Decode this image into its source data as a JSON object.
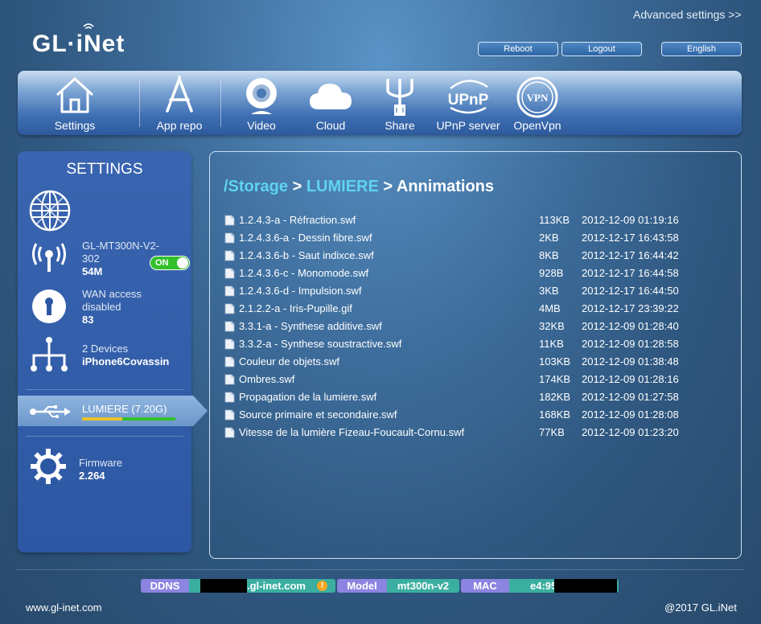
{
  "header": {
    "advanced_link": "Advanced settings >>",
    "logo": "GL·iNet",
    "reboot": "Reboot",
    "logout": "Logout",
    "language": "English"
  },
  "toolbar": {
    "items": [
      {
        "label": "Settings",
        "icon": "house-icon"
      },
      {
        "label": "App repo",
        "icon": "app-repo-icon"
      },
      {
        "label": "Video",
        "icon": "webcam-icon"
      },
      {
        "label": "Cloud",
        "icon": "cloud-icon"
      },
      {
        "label": "Share",
        "icon": "usb-share-icon"
      },
      {
        "label": "UPnP server",
        "icon": "upnp-icon"
      },
      {
        "label": "OpenVpn",
        "icon": "vpn-icon"
      }
    ],
    "upnp_badge": "UPnP",
    "vpn_badge": "VPN"
  },
  "sidebar": {
    "title": "SETTINGS",
    "wifi": {
      "ssid": "GL-MT300N-V2-302",
      "ssid_line1": "GL-MT300N-V2-",
      "ssid_line2": "302",
      "speed": "54M",
      "toggle": "ON"
    },
    "wan": {
      "line1": "WAN access",
      "line2": "disabled",
      "value": "83"
    },
    "devices": {
      "line1": "2 Devices",
      "line2": "iPhone6Covassin"
    },
    "usb": {
      "label": "LUMIERE (7.20G)",
      "usage": 0.43
    },
    "firmware": {
      "label": "Firmware",
      "version": "2.264"
    }
  },
  "breadcrumb": {
    "root": "/Storage",
    "sep1": " > ",
    "folder": "LUMIERE",
    "sep2": " > ",
    "current": "Annimations"
  },
  "files": [
    {
      "name": "1.2.4.3-a - Réfraction.swf",
      "size": "113KB",
      "date": "2012-12-09 01:19:16"
    },
    {
      "name": "1.2.4.3.6-a - Dessin fibre.swf",
      "size": "2KB",
      "date": "2012-12-17 16:43:58"
    },
    {
      "name": "1.2.4.3.6-b - Saut indixce.swf",
      "size": "8KB",
      "date": "2012-12-17 16:44:42"
    },
    {
      "name": "1.2.4.3.6-c - Monomode.swf",
      "size": "928B",
      "date": "2012-12-17 16:44:58"
    },
    {
      "name": "1.2.4.3.6-d - Impulsion.swf",
      "size": "3KB",
      "date": "2012-12-17 16:44:50"
    },
    {
      "name": "2.1.2.2-a - Iris-Pupille.gif",
      "size": "4MB",
      "date": "2012-12-17 23:39:22"
    },
    {
      "name": "3.3.1-a - Synthese additive.swf",
      "size": "32KB",
      "date": "2012-12-09 01:28:40"
    },
    {
      "name": "3.3.2-a - Synthese soustractive.swf",
      "size": "11KB",
      "date": "2012-12-09 01:28:58"
    },
    {
      "name": "Couleur de objets.swf",
      "size": "103KB",
      "date": "2012-12-09 01:38:48"
    },
    {
      "name": "Ombres.swf",
      "size": "174KB",
      "date": "2012-12-09 01:28:16"
    },
    {
      "name": "Propagation de la lumiere.swf",
      "size": "182KB",
      "date": "2012-12-09 01:27:58"
    },
    {
      "name": "Source primaire et secondaire.swf",
      "size": "168KB",
      "date": "2012-12-09 01:28:08"
    },
    {
      "name": "Vitesse de la lumière Fizeau-Foucault-Cornu.swf",
      "size": "77KB",
      "date": "2012-12-09 01:23:20"
    }
  ],
  "status_bar": {
    "ddns_label": "DDNS",
    "ddns_value": ".gl-inet.com",
    "warn": "!",
    "model_label": "Model",
    "model_value": "mt300n-v2",
    "mac_label": "MAC",
    "mac_value": "e4:95:"
  },
  "footer": {
    "left": "www.gl-inet.com",
    "right": "@2017 GL.iNet"
  },
  "colors": {
    "accent_link": "#5fd3f0",
    "toggle_on": "#34c02d",
    "status_label": "#8b84e0",
    "status_value": "#3aaea0",
    "usage_bar": "#e8c22a"
  }
}
